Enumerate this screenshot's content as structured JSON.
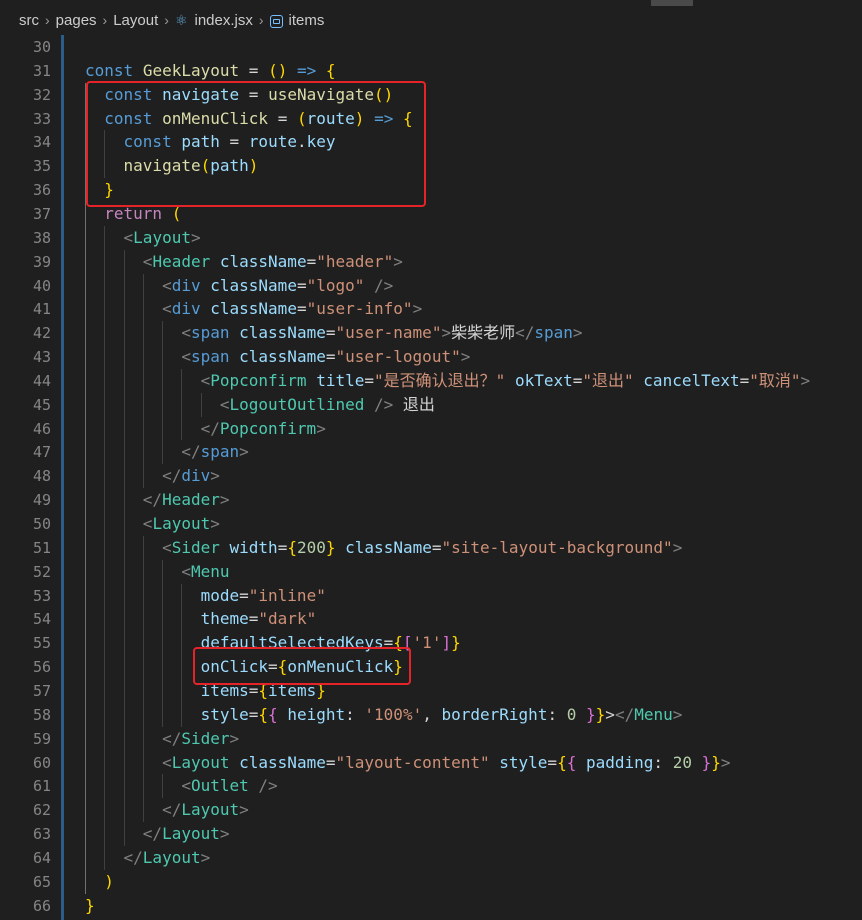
{
  "breadcrumb": {
    "items": [
      "src",
      "pages",
      "Layout",
      "index.jsx",
      "items"
    ]
  },
  "icons": {
    "file_icon": "react-file-icon",
    "symbol_icon": "symbol-variable-icon"
  },
  "colors": {
    "background": "#1f1f1f",
    "highlight_border": "#e5242a",
    "keyword": "#569cd6",
    "function": "#dcdcaa",
    "string": "#ce9178",
    "component": "#4ec9b0"
  },
  "lines": [
    {
      "n": "30",
      "t": ""
    },
    {
      "n": "31",
      "t": "const GeekLayout = () => {"
    },
    {
      "n": "32",
      "t": "  const navigate = useNavigate()"
    },
    {
      "n": "33",
      "t": "  const onMenuClick = (route) => {"
    },
    {
      "n": "34",
      "t": "    const path = route.key"
    },
    {
      "n": "35",
      "t": "    navigate(path)"
    },
    {
      "n": "36",
      "t": "  }"
    },
    {
      "n": "37",
      "t": "  return ("
    },
    {
      "n": "38",
      "t": "    <Layout>"
    },
    {
      "n": "39",
      "t": "      <Header className=\"header\">"
    },
    {
      "n": "40",
      "t": "        <div className=\"logo\" />"
    },
    {
      "n": "41",
      "t": "        <div className=\"user-info\">"
    },
    {
      "n": "42",
      "t": "          <span className=\"user-name\">柴柴老师</span>"
    },
    {
      "n": "43",
      "t": "          <span className=\"user-logout\">"
    },
    {
      "n": "44",
      "t": "            <Popconfirm title=\"是否确认退出？\" okText=\"退出\" cancelText=\"取消\">"
    },
    {
      "n": "45",
      "t": "              <LogoutOutlined /> 退出"
    },
    {
      "n": "46",
      "t": "            </Popconfirm>"
    },
    {
      "n": "47",
      "t": "          </span>"
    },
    {
      "n": "48",
      "t": "        </div>"
    },
    {
      "n": "49",
      "t": "      </Header>"
    },
    {
      "n": "50",
      "t": "      <Layout>"
    },
    {
      "n": "51",
      "t": "        <Sider width={200} className=\"site-layout-background\">"
    },
    {
      "n": "52",
      "t": "          <Menu"
    },
    {
      "n": "53",
      "t": "            mode=\"inline\""
    },
    {
      "n": "54",
      "t": "            theme=\"dark\""
    },
    {
      "n": "55",
      "t": "            defaultSelectedKeys={['1']}"
    },
    {
      "n": "56",
      "t": "            onClick={onMenuClick}"
    },
    {
      "n": "57",
      "t": "            items={items}"
    },
    {
      "n": "58",
      "t": "            style={{ height: '100%', borderRight: 0 }}></Menu>"
    },
    {
      "n": "59",
      "t": "        </Sider>"
    },
    {
      "n": "60",
      "t": "        <Layout className=\"layout-content\" style={{ padding: 20 }}>"
    },
    {
      "n": "61",
      "t": "          <Outlet />"
    },
    {
      "n": "62",
      "t": "        </Layout>"
    },
    {
      "n": "63",
      "t": "      </Layout>"
    },
    {
      "n": "64",
      "t": "    </Layout>"
    },
    {
      "n": "65",
      "t": "  )"
    },
    {
      "n": "66",
      "t": "}"
    }
  ]
}
